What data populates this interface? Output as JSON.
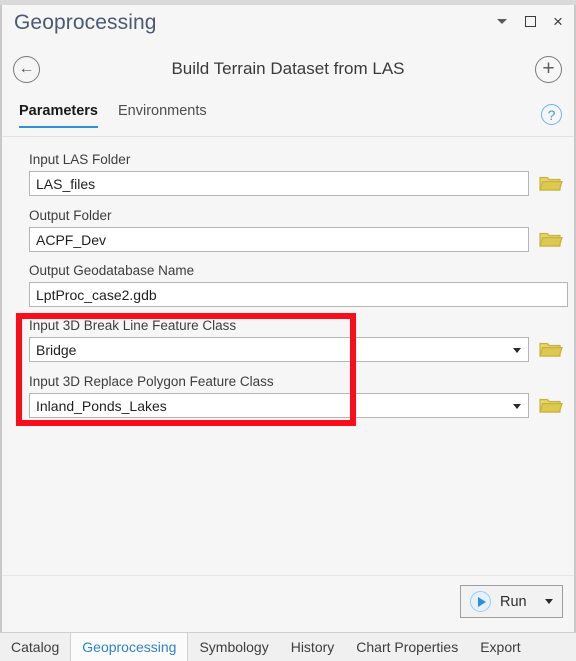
{
  "window": {
    "title": "Geoprocessing",
    "controls": [
      {
        "name": "minimize-dropdown",
        "glyph": "caret-down"
      },
      {
        "name": "restore",
        "glyph": "square"
      },
      {
        "name": "close",
        "glyph": "×"
      }
    ]
  },
  "tool_header": {
    "back_icon": "←",
    "title": "Build Terrain Dataset from LAS",
    "add_icon": "+"
  },
  "tabs": {
    "items": [
      {
        "label": "Parameters",
        "active": true
      },
      {
        "label": "Environments",
        "active": false
      }
    ],
    "help_icon": "?"
  },
  "parameters": {
    "fields": [
      {
        "label": "Input LAS Folder",
        "value": "LAS_files",
        "type": "text",
        "has_browse": true,
        "has_dropdown": false,
        "highlighted": false
      },
      {
        "label": "Output Folder",
        "value": "ACPF_Dev",
        "type": "text",
        "has_browse": true,
        "has_dropdown": false,
        "highlighted": false
      },
      {
        "label": "Output Geodatabase Name",
        "value": "LptProc_case2.gdb",
        "type": "text",
        "has_browse": false,
        "has_dropdown": false,
        "highlighted": false
      },
      {
        "label": "Input 3D Break Line Feature Class",
        "value": "Bridge",
        "type": "combo",
        "has_browse": true,
        "has_dropdown": true,
        "highlighted": true
      },
      {
        "label": "Input 3D Replace Polygon Feature Class",
        "value": "Inland_Ponds_Lakes",
        "type": "combo",
        "has_browse": true,
        "has_dropdown": true,
        "highlighted": true
      }
    ]
  },
  "highlight": {
    "color": "#fc0d1b",
    "covers": [
      "Input 3D Break Line Feature Class",
      "Input 3D Replace Polygon Feature Class"
    ]
  },
  "run_bar": {
    "run_label": "Run",
    "play_icon": "play-icon",
    "split_icon": "chevron-down-icon"
  },
  "dock_tabs": {
    "items": [
      {
        "label": "Catalog",
        "active": false
      },
      {
        "label": "Geoprocessing",
        "active": true
      },
      {
        "label": "Symbology",
        "active": false
      },
      {
        "label": "History",
        "active": false
      },
      {
        "label": "Chart Properties",
        "active": false
      },
      {
        "label": "Export",
        "active": false
      }
    ]
  },
  "colors": {
    "accent": "#2f8fd8",
    "highlight": "#fc0d1b",
    "folder": "#d9c14a",
    "panel_bg": "#f6f6f6"
  }
}
